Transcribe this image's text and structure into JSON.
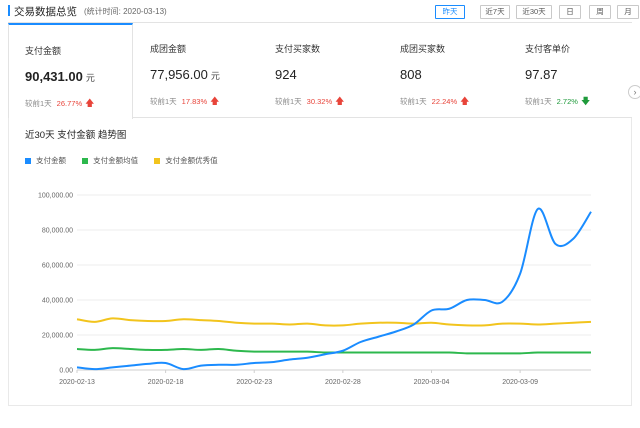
{
  "header": {
    "title": "交易数据总览",
    "subtitle": "(统计时间: 2020-03-13)",
    "ranges": [
      {
        "label": "昨天",
        "active": true
      },
      {
        "label": "近7天",
        "active": false
      },
      {
        "label": "近30天",
        "active": false
      },
      {
        "label": "日",
        "active": false
      },
      {
        "label": "周",
        "active": false
      },
      {
        "label": "月",
        "active": false
      }
    ]
  },
  "cards": [
    {
      "label": "支付金额",
      "value": "90,431.00",
      "unit": "元",
      "compare_label": "较前1天",
      "change": "26.77%",
      "direction": "up"
    },
    {
      "label": "成团金额",
      "value": "77,956.00",
      "unit": "元",
      "compare_label": "较前1天",
      "change": "17.83%",
      "direction": "up"
    },
    {
      "label": "支付买家数",
      "value": "924",
      "unit": "",
      "compare_label": "较前1天",
      "change": "30.32%",
      "direction": "up"
    },
    {
      "label": "成团买家数",
      "value": "808",
      "unit": "",
      "compare_label": "较前1天",
      "change": "22.24%",
      "direction": "up"
    },
    {
      "label": "支付客单价",
      "value": "97.87",
      "unit": "",
      "compare_label": "较前1天",
      "change": "2.72%",
      "direction": "down"
    }
  ],
  "arrows": {
    "up": "🡅",
    "down": "🡇",
    "next": "›"
  },
  "colors": {
    "accent": "#1a8cff",
    "up": "#e8443a",
    "down": "#1f9a3b"
  },
  "chart": {
    "title": "近30天 支付金额 趋势图"
  },
  "chart_data": {
    "type": "line",
    "title": "近30天 支付金额 趋势图",
    "xlabel": "",
    "ylabel": "",
    "ylim": [
      0,
      100000
    ],
    "yticks": [
      "0.00",
      "20,000.00",
      "40,000.00",
      "60,000.00",
      "80,000.00",
      "100,000.00"
    ],
    "ytick_values": [
      0,
      20000,
      40000,
      60000,
      80000,
      100000
    ],
    "x": [
      "2020-02-13",
      "2020-02-14",
      "2020-02-15",
      "2020-02-16",
      "2020-02-17",
      "2020-02-18",
      "2020-02-19",
      "2020-02-20",
      "2020-02-21",
      "2020-02-22",
      "2020-02-23",
      "2020-02-24",
      "2020-02-25",
      "2020-02-26",
      "2020-02-27",
      "2020-02-28",
      "2020-02-29",
      "2020-03-01",
      "2020-03-02",
      "2020-03-03",
      "2020-03-04",
      "2020-03-05",
      "2020-03-06",
      "2020-03-07",
      "2020-03-08",
      "2020-03-09",
      "2020-03-10",
      "2020-03-11",
      "2020-03-12",
      "2020-03-13"
    ],
    "xticks": [
      "2020-02-13",
      "2020-02-18",
      "2020-02-23",
      "2020-02-28",
      "2020-03-04",
      "2020-03-09"
    ],
    "legend_position": "top-left",
    "grid": "horizontal",
    "series": [
      {
        "name": "支付金额",
        "color": "#1a8cff",
        "values": [
          1500,
          500,
          1500,
          2500,
          3500,
          4000,
          500,
          2500,
          3000,
          3000,
          4000,
          4500,
          6000,
          7000,
          9000,
          11000,
          16000,
          19000,
          22000,
          26000,
          34000,
          35000,
          40000,
          40000,
          39000,
          55000,
          92000,
          72000,
          75000,
          90431
        ]
      },
      {
        "name": "支付金额均值",
        "color": "#2db84d",
        "values": [
          12000,
          11500,
          12500,
          12000,
          11500,
          11500,
          12000,
          11500,
          12000,
          11000,
          10500,
          10500,
          10500,
          10500,
          10000,
          10000,
          10000,
          10000,
          10000,
          10000,
          10000,
          10000,
          9500,
          9500,
          9500,
          9500,
          10000,
          10000,
          10000,
          10000
        ]
      },
      {
        "name": "支付金额优秀值",
        "color": "#f2c41d",
        "values": [
          29000,
          27500,
          29500,
          28500,
          28000,
          28000,
          29000,
          28500,
          28000,
          27000,
          26500,
          26500,
          26000,
          26500,
          25500,
          25500,
          26500,
          27000,
          27000,
          26500,
          27000,
          26000,
          25500,
          25500,
          26500,
          26500,
          26000,
          26500,
          27000,
          27500
        ]
      }
    ]
  }
}
